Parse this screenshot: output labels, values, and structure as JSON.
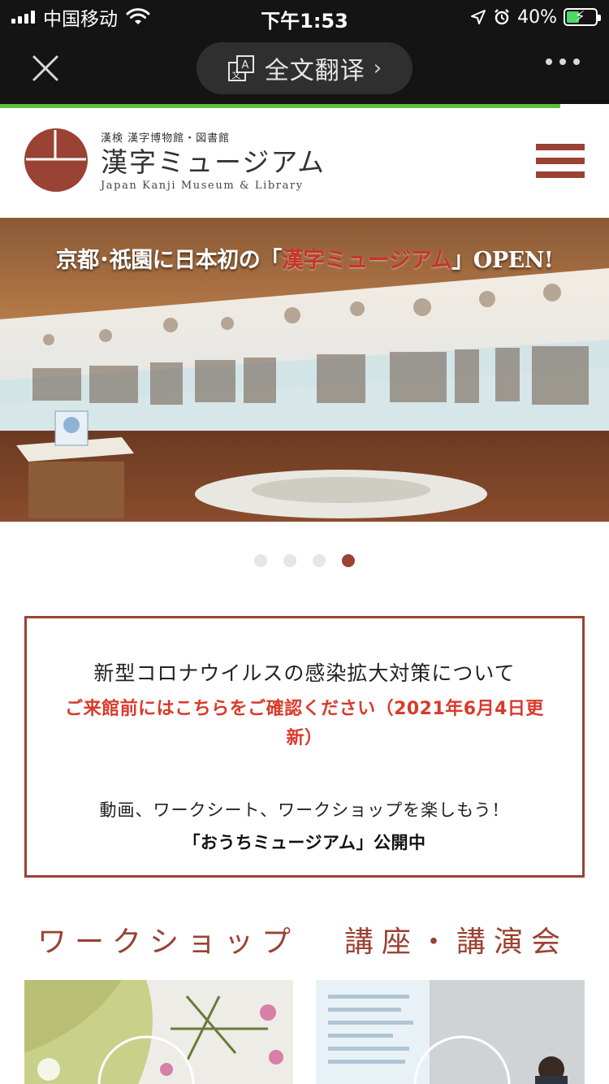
{
  "status_bar": {
    "carrier": "中国移动",
    "time": "下午1:53",
    "battery_percent": "40%",
    "battery_level": 0.4,
    "icons": [
      "signal-icon",
      "wifi-icon",
      "location-icon",
      "alarm-icon",
      "battery-charging-icon"
    ]
  },
  "browser_bar": {
    "translate_label": "全文翻译",
    "icons": [
      "close-icon",
      "translate-icon",
      "chevron-right-icon",
      "more-icon"
    ],
    "load_progress": 0.92
  },
  "header": {
    "logo_sub": "漢検 漢字博物館・図書館",
    "logo_main": "漢字ミュージアム",
    "logo_en": "Japan Kanji Museum & Library",
    "menu_icon": "hamburger-menu-icon",
    "brand_color": "#9a4233"
  },
  "hero": {
    "caption_prefix": "京都･祇園に日本初の「",
    "caption_highlight": "漢字ミュージアム",
    "caption_suffix": "」OPEN!",
    "highlight_color": "#c4362b"
  },
  "carousel": {
    "slide_count": 4,
    "active_index": 3
  },
  "notice": {
    "title": "新型コロナウイルスの感染拡大対策について",
    "link_text": "ご来館前にはこちらをご確認ください（2021年6月4日更新）",
    "link_color": "#d93a2b",
    "body": "動画、ワークシート、ワークショップを楽しもう！",
    "strong": "「おうちミュージアム」公開中"
  },
  "sections": {
    "workshop_title": "ワークショップ",
    "lecture_title": "講座・講演会"
  }
}
